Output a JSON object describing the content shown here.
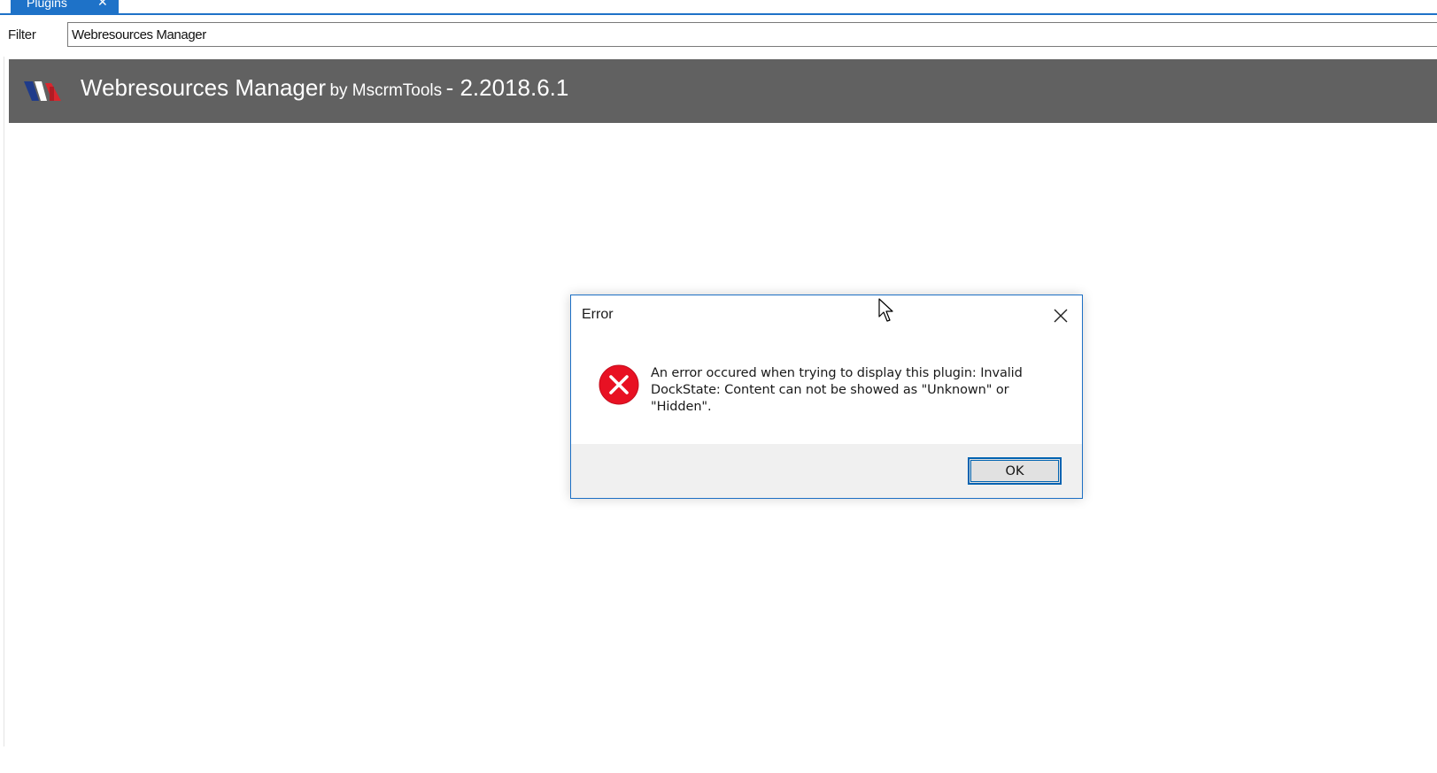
{
  "tab": {
    "label": "Plugins",
    "close_glyph": "✕"
  },
  "filter": {
    "label": "Filter",
    "value": "Webresources Manager"
  },
  "plugin_header": {
    "name": "Webresources Manager",
    "by": "by MscrmTools",
    "version": "- 2.2018.6.1",
    "logo_icon": "mscrmtools-logo-icon"
  },
  "dialog": {
    "title": "Error",
    "message": "An error occured when trying to display this plugin: Invalid DockState: Content can not be showed as \"Unknown\" or \"Hidden\".",
    "ok_label": "OK",
    "icon": "error-icon"
  },
  "colors": {
    "accent": "#1e72c8",
    "header_bg": "#616161",
    "error_red": "#e81123",
    "footer_bg": "#f0f0f0"
  }
}
